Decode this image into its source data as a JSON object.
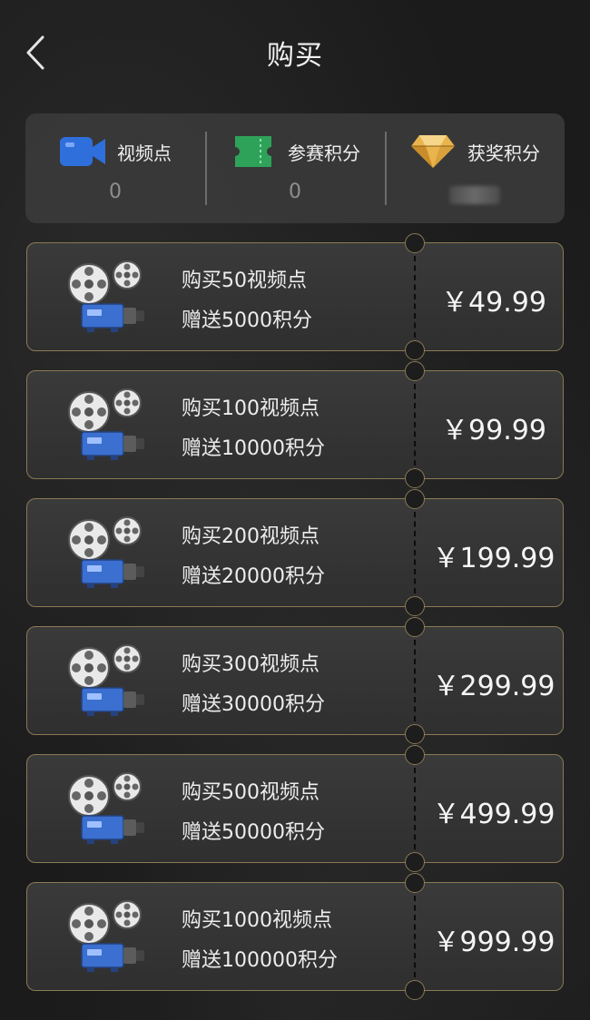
{
  "header": {
    "title": "购买",
    "back_icon": "chevron-left-icon"
  },
  "stats": [
    {
      "label": "视频点",
      "value": "0",
      "icon": "video-camera-icon"
    },
    {
      "label": "参赛积分",
      "value": "0",
      "icon": "ticket-icon"
    },
    {
      "label": "获奖积分",
      "value": "",
      "icon": "diamond-icon",
      "value_blurred": true
    }
  ],
  "packages": [
    {
      "line1": "购买50视频点",
      "line2": "赠送5000积分",
      "price": "￥49.99"
    },
    {
      "line1": "购买100视频点",
      "line2": "赠送10000积分",
      "price": "￥99.99"
    },
    {
      "line1": "购买200视频点",
      "line2": "赠送20000积分",
      "price": "￥199.99"
    },
    {
      "line1": "购买300视频点",
      "line2": "赠送30000积分",
      "price": "￥299.99"
    },
    {
      "line1": "购买500视频点",
      "line2": "赠送50000积分",
      "price": "￥499.99"
    },
    {
      "line1": "购买1000视频点",
      "line2": "赠送100000积分",
      "price": "￥999.99"
    }
  ],
  "colors": {
    "accent_border": "#8a7a55",
    "video_icon_blue": "#2f6fdc",
    "ticket_icon_green": "#2fa25a",
    "diamond_gold": "#e9b44c"
  }
}
